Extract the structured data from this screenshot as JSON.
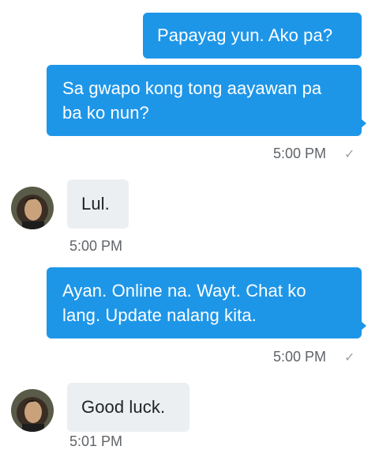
{
  "messages": {
    "m1": {
      "text": "Papayag yun. Ako pa?"
    },
    "m2": {
      "text": "Sa gwapo kong tong aayawan pa ba ko nun?",
      "time": "5:00 PM",
      "status_icon": "check-icon"
    },
    "m3": {
      "text": "Lul.",
      "time": "5:00 PM"
    },
    "m4": {
      "text": "Ayan. Online na. Wayt. Chat ko lang. Update nalang kita.",
      "time": "5:00 PM",
      "status_icon": "check-icon"
    },
    "m5": {
      "text": "Good luck.",
      "time": "5:01 PM"
    }
  },
  "icons": {
    "check": "✓"
  },
  "colors": {
    "outgoing_bubble": "#1e96e8",
    "incoming_bubble": "#eceff1",
    "timestamp": "#606468"
  }
}
